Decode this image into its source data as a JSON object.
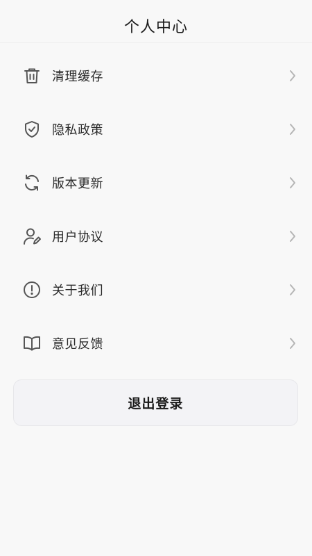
{
  "header": {
    "title": "个人中心"
  },
  "menu": {
    "items": [
      {
        "label": "清理缓存",
        "icon": "trash-icon"
      },
      {
        "label": "隐私政策",
        "icon": "shield-check-icon"
      },
      {
        "label": "版本更新",
        "icon": "refresh-icon"
      },
      {
        "label": "用户协议",
        "icon": "user-edit-icon"
      },
      {
        "label": "关于我们",
        "icon": "info-icon"
      },
      {
        "label": "意见反馈",
        "icon": "book-icon"
      }
    ]
  },
  "logout": {
    "label": "退出登录"
  },
  "colors": {
    "background": "#f8f8f8",
    "icon": "#555555",
    "chevron": "#b5b5b5",
    "button_bg": "#f3f3f6"
  }
}
